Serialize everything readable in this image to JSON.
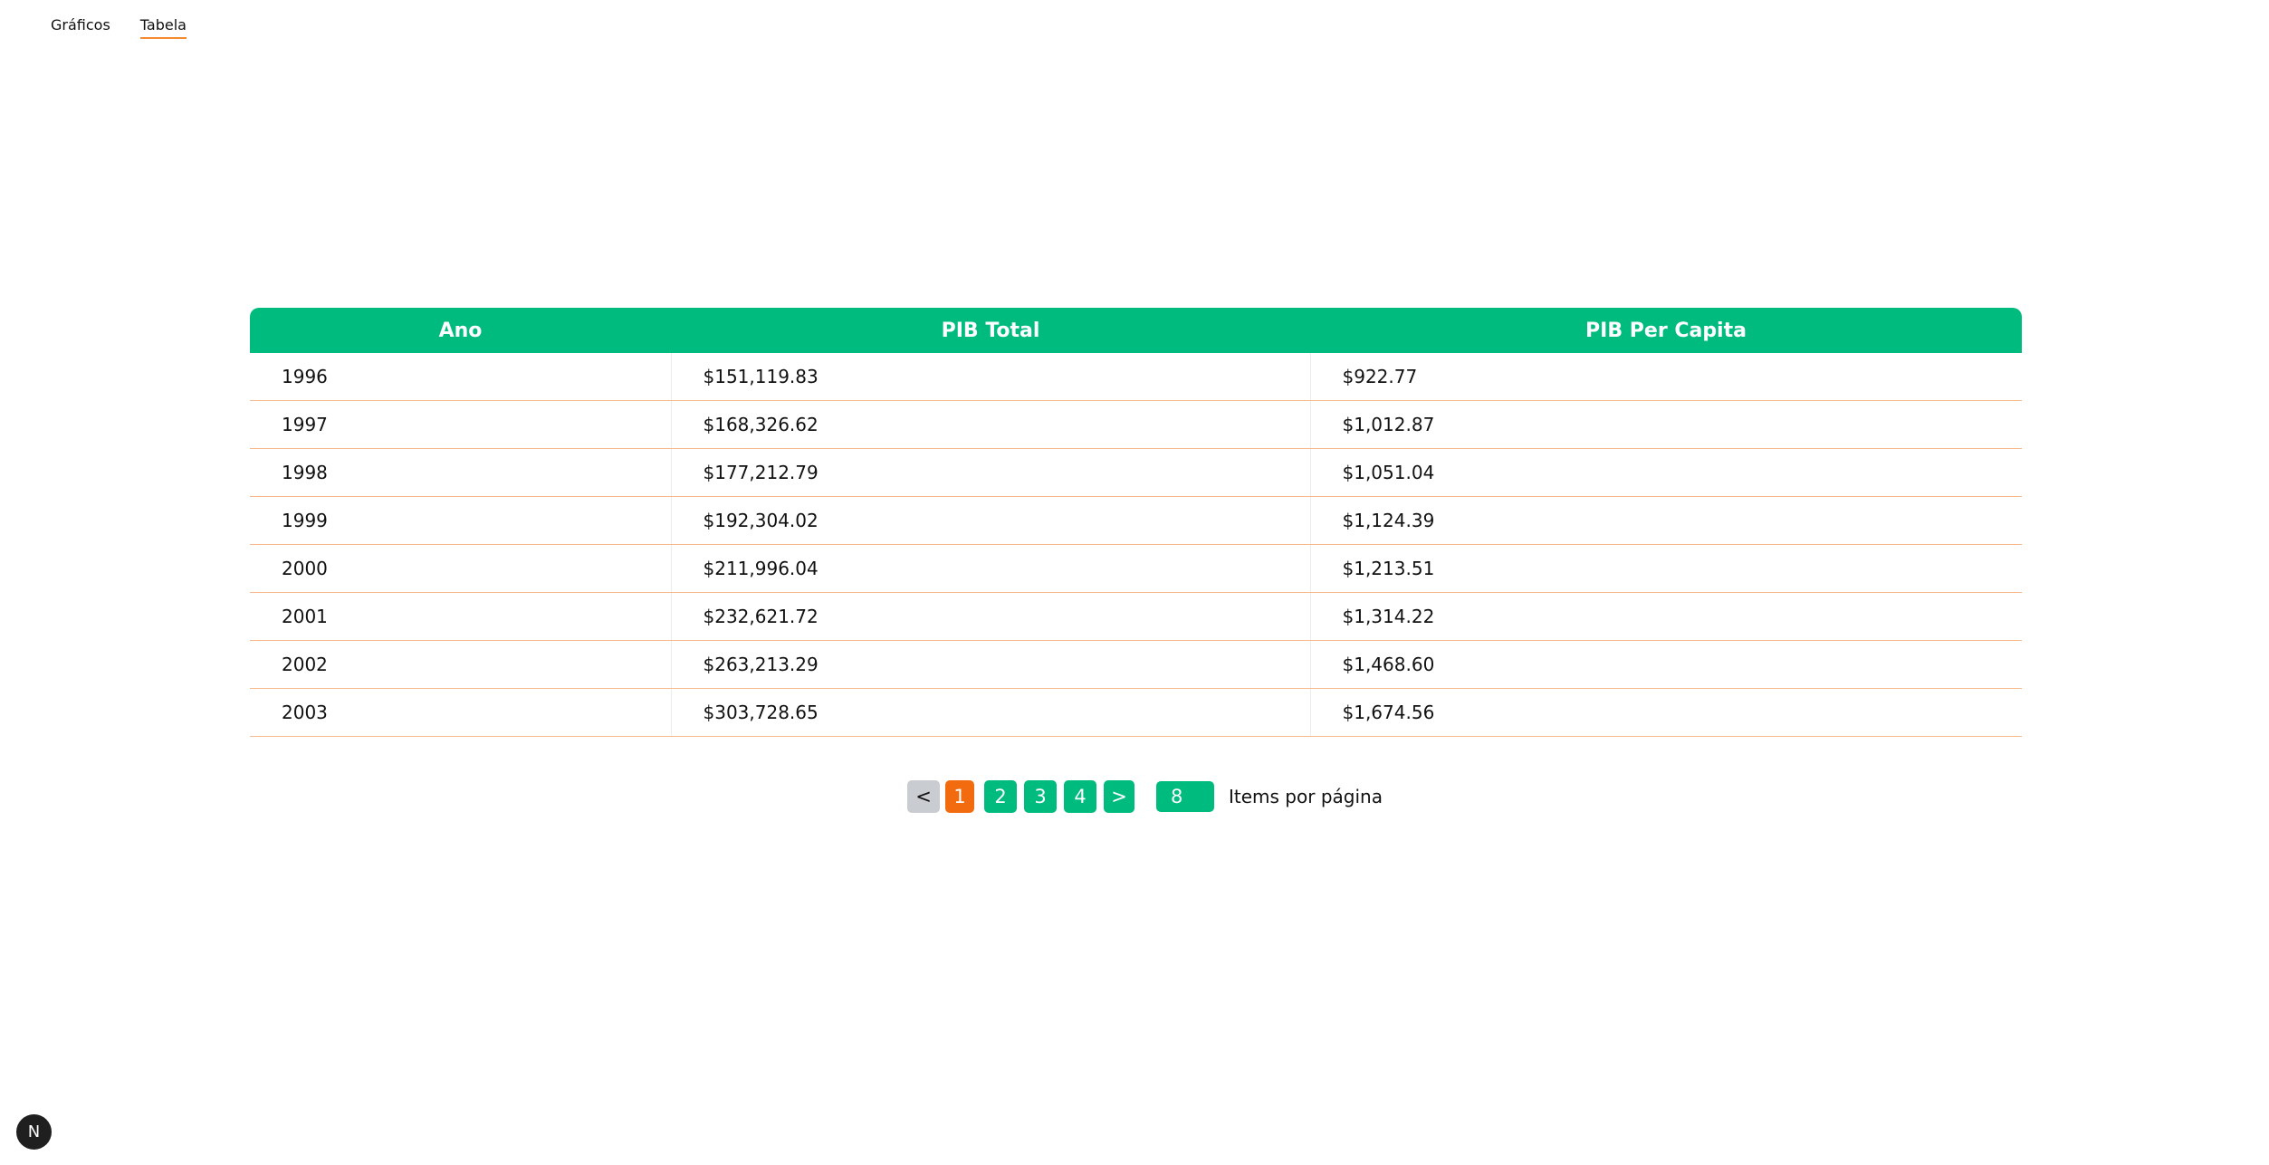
{
  "nav": {
    "items": [
      {
        "label": "Gráficos",
        "active": false
      },
      {
        "label": "Tabela",
        "active": true
      }
    ]
  },
  "table": {
    "headers": [
      "Ano",
      "PIB Total",
      "PIB Per Capita"
    ],
    "rows": [
      [
        "1996",
        "$151,119.83",
        "$922.77"
      ],
      [
        "1997",
        "$168,326.62",
        "$1,012.87"
      ],
      [
        "1998",
        "$177,212.79",
        "$1,051.04"
      ],
      [
        "1999",
        "$192,304.02",
        "$1,124.39"
      ],
      [
        "2000",
        "$211,996.04",
        "$1,213.51"
      ],
      [
        "2001",
        "$232,621.72",
        "$1,314.22"
      ],
      [
        "2002",
        "$263,213.29",
        "$1,468.60"
      ],
      [
        "2003",
        "$303,728.65",
        "$1,674.56"
      ]
    ]
  },
  "pagination": {
    "prev_label": "<",
    "next_label": ">",
    "pages": [
      "1",
      "2",
      "3",
      "4"
    ],
    "current_page": "1",
    "items_per_page": "8",
    "items_per_page_label": "Items por página"
  },
  "badge": {
    "label": "N"
  },
  "colors": {
    "accent_green": "#00bb7e",
    "accent_orange": "#f36b0f",
    "row_divider": "#f7b98a",
    "disabled_gray": "#c9ccd0"
  }
}
